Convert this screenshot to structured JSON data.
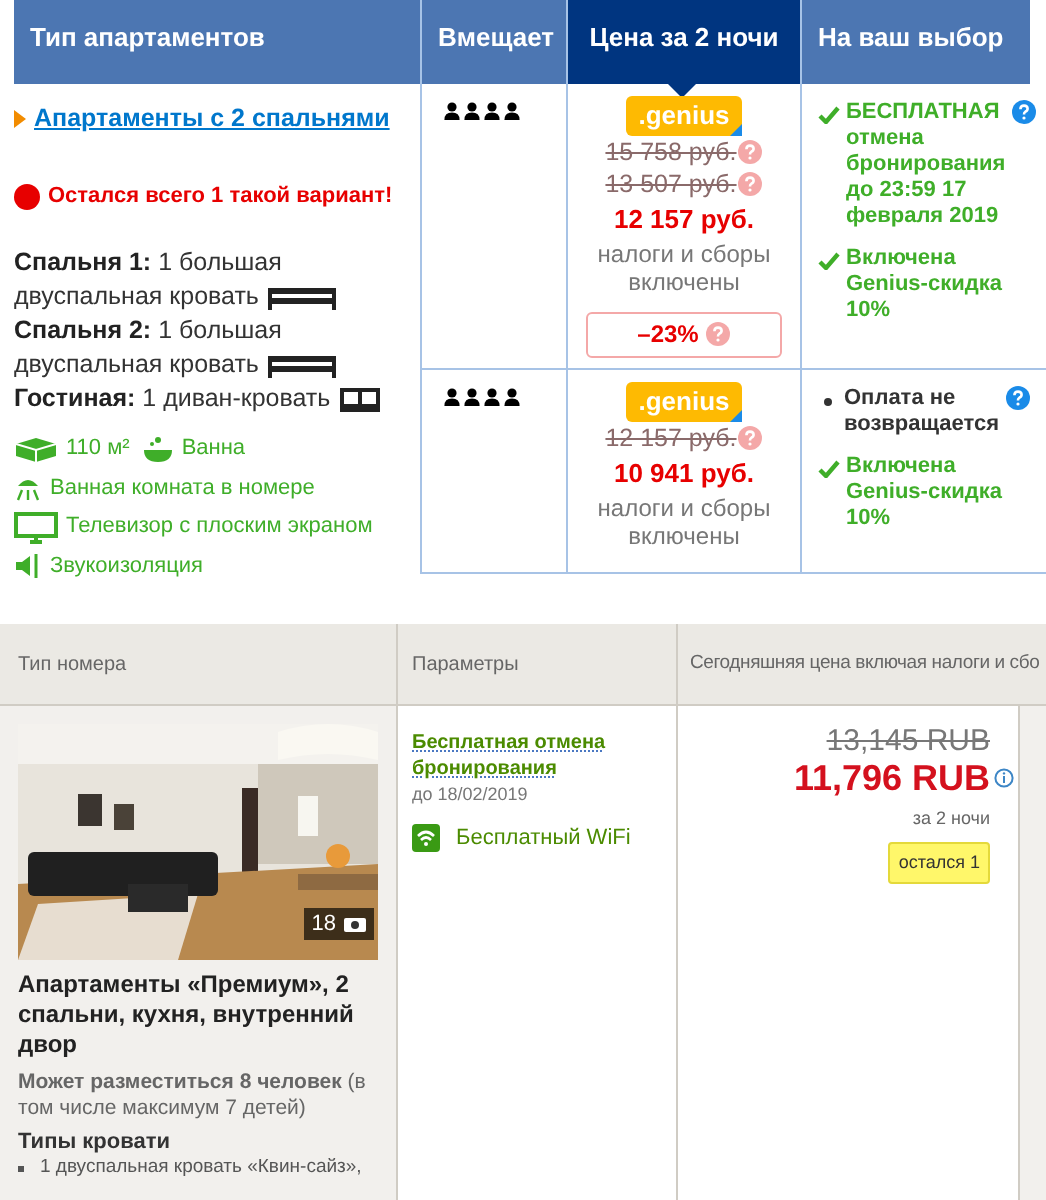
{
  "top_table": {
    "columns": [
      {
        "label": "Тип апартаментов",
        "selected": false
      },
      {
        "label": "Вмещает",
        "selected": false
      },
      {
        "label": "Цена за 2 ночи",
        "selected": true
      },
      {
        "label": "На ваш выбор",
        "selected": false
      }
    ],
    "room": {
      "link": "Апартаменты с 2 спальнями",
      "urgency": "Остался всего 1 такой вариант!",
      "beds": [
        {
          "label": "Спальня 1:",
          "value": "1 большая двуспальная кровать",
          "kind": "bed"
        },
        {
          "label": "Спальня 2:",
          "value": "1 большая двуспальная кровать",
          "kind": "bed"
        },
        {
          "label": "Гостиная:",
          "value": "1 диван-кровать",
          "kind": "sofa"
        }
      ],
      "facilities": [
        [
          {
            "kind": "area",
            "text": "110 м²"
          },
          {
            "kind": "bath",
            "text": "Ванна"
          }
        ],
        [
          {
            "kind": "shower",
            "text": "Ванная комната в номере"
          }
        ],
        [
          {
            "kind": "tv",
            "text": "Телевизор с плоским экраном"
          }
        ],
        [
          {
            "kind": "sound",
            "text": "Звукоизоляция"
          }
        ]
      ]
    },
    "offers": [
      {
        "badge": ".genius",
        "old_prices": [
          "15 758 руб.",
          "13 507 руб."
        ],
        "price": "12 157 руб.",
        "note": "налоги и сборы включены",
        "discount": "–23%",
        "conditions": [
          {
            "kind": "check",
            "text": "БЕСПЛАТНАЯ отмена бронирования до 23:59 17 февраля 2019",
            "help": true
          },
          {
            "kind": "check",
            "text": "Включена Genius-скидка 10%",
            "help": false
          }
        ]
      },
      {
        "badge": ".genius",
        "old_prices": [
          "12 157 руб."
        ],
        "price": "10 941 руб.",
        "note": "налоги и сборы включены",
        "conditions": [
          {
            "kind": "bullet",
            "text": "Оплата не возвращается",
            "help": true
          },
          {
            "kind": "check",
            "text": "Включена Genius-скидка 10%",
            "help": false
          }
        ]
      }
    ]
  },
  "bottom_table": {
    "columns": [
      "Тип номера",
      "Параметры",
      "Сегодняшняя цена включая налоги и сбо"
    ],
    "room": {
      "photo_count": "18",
      "title": "Апартаменты «Премиум», 2 спальни, кухня, внутренний двор",
      "capacity": "**Может разместиться 8 человек** (в том числе максимум 7 детей)",
      "beds_heading": "Типы кровати",
      "beds": [
        "1 двуспальная кровать «Квин-сайз»,"
      ]
    },
    "params": {
      "cancel": "Бесплатная отмена бронирования",
      "cancel_date": "до 18/02/2019",
      "wifi": "Бесплатный WiFi"
    },
    "price": {
      "old": "13,145 RUB",
      "new": "11,796 RUB",
      "per": "за 2 ночи",
      "badge": "остался 1"
    }
  }
}
